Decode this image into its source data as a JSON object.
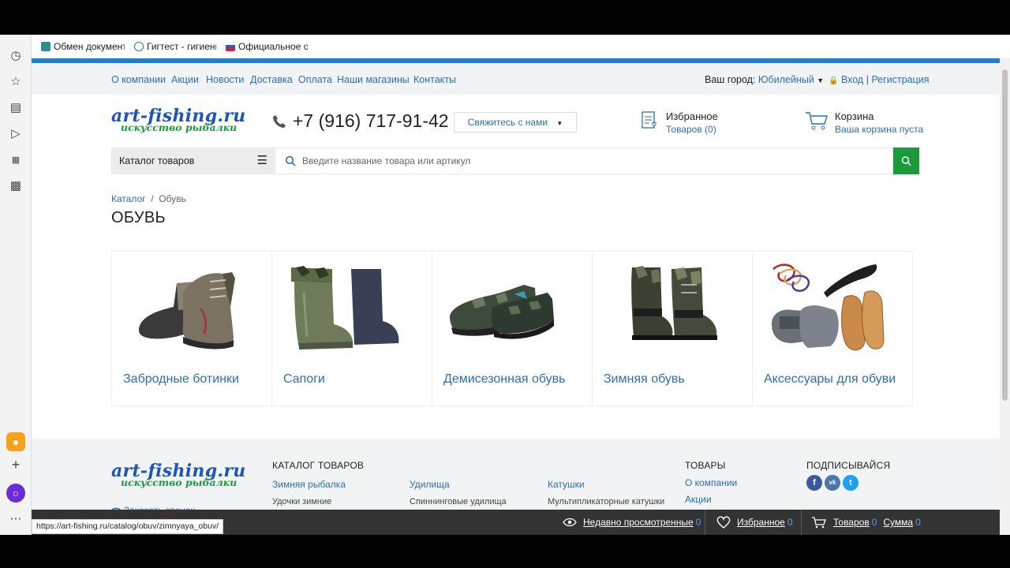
{
  "bookmarks": [
    {
      "label": "Обмен документа",
      "color": "#2a8f8f"
    },
    {
      "label": "Гигтест - гигиенич",
      "color": "#ffffff"
    },
    {
      "label": "Официальное опу",
      "color": "#5577cc"
    }
  ],
  "topnav": {
    "links": [
      "О компании",
      "Акции",
      "Новости",
      "Доставка",
      "Оплата",
      "Наши магазины",
      "Контакты"
    ],
    "city_label": "Ваш город:",
    "city_value": "Юбилейный",
    "login": "Вход",
    "separator": "|",
    "register": "Регистрация"
  },
  "header": {
    "logo_main": "art-fishing.ru",
    "logo_sub": "искусство рыбалки",
    "phone": "+7 (916) 717-91-42",
    "contact_button": "Свяжитесь с нами",
    "favorites_title": "Избранное",
    "favorites_sub": "Товаров (0)",
    "cart_title": "Корзина",
    "cart_sub": "Ваша корзина пуста"
  },
  "catalog_button": "Каталог товаров",
  "search": {
    "placeholder": "Введите название товара или артикул"
  },
  "breadcrumb": {
    "root": "Каталог",
    "sep": "/",
    "current": "Обувь"
  },
  "page_title": "ОБУВЬ",
  "categories": [
    "Забродные ботинки",
    "Сапоги",
    "Демисезонная обувь",
    "Зимняя обувь",
    "Аксессуары для обуви"
  ],
  "footer": {
    "logo_main": "art-fishing.ru",
    "logo_sub": "искусство рыбалки",
    "order_call": "Заказать звонок",
    "catalog_heading": "КАТАЛОГ ТОВАРОВ",
    "cat_cols": [
      {
        "title": "Зимняя рыбалка",
        "sub": "Удочки зимние"
      },
      {
        "title": "Удилища",
        "sub": "Спиннинговые удилища"
      },
      {
        "title": "Катушки",
        "sub": "Мультипликаторные катушки"
      }
    ],
    "goods_heading": "ТОВАРЫ",
    "goods_links": [
      "О компании",
      "Акции"
    ],
    "subscribe_heading": "ПОДПИСЫВАЙСЯ",
    "social": [
      {
        "glyph": "f",
        "color": "#3b5998"
      },
      {
        "glyph": "vk",
        "color": "#4a76a8"
      },
      {
        "glyph": "t",
        "color": "#1da1f2"
      }
    ]
  },
  "bottom_bar": {
    "recent_label": "Недавно просмотренные",
    "recent_count": "0",
    "fav_label": "Избранное",
    "fav_count": "0",
    "goods_label": "Товаров",
    "goods_count": "0",
    "sum_label": "Сумма",
    "sum_count": "0"
  },
  "status_url": "https://art-fishing.ru/catalog/obuv/zimnyaya_obuv/"
}
